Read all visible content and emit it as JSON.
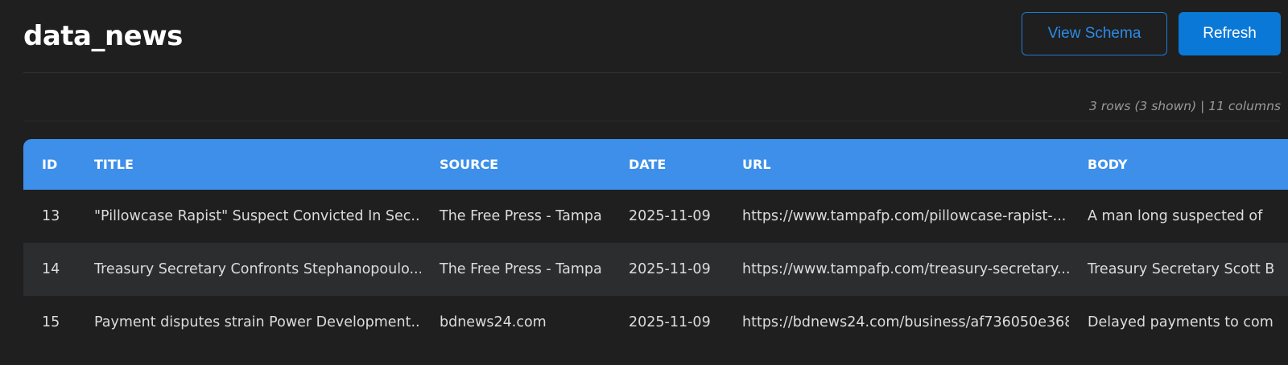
{
  "header": {
    "title": "data_news",
    "view_schema_label": "View Schema",
    "refresh_label": "Refresh"
  },
  "meta": {
    "summary": "3 rows (3 shown) | 11 columns"
  },
  "colors": {
    "header_bg": "#3d8fea",
    "primary_button": "#0a78d6",
    "outline_button": "#1f7ad6",
    "page_bg": "#1f1f1f",
    "alt_row_bg": "#2b2d2f"
  },
  "table": {
    "columns": [
      "ID",
      "TITLE",
      "SOURCE",
      "DATE",
      "URL",
      "BODY"
    ],
    "rows": [
      {
        "id": "13",
        "title": "\"Pillowcase Rapist\" Suspect Convicted In Sec...",
        "source": "The Free Press - Tampa",
        "date": "2025-11-09",
        "url": "https://www.tampafp.com/pillowcase-rapist-...",
        "body": "A man long suspected of"
      },
      {
        "id": "14",
        "title": "Treasury Secretary Confronts Stephanopoulo...",
        "source": "The Free Press - Tampa",
        "date": "2025-11-09",
        "url": "https://www.tampafp.com/treasury-secretary...",
        "body": "Treasury Secretary Scott B"
      },
      {
        "id": "15",
        "title": "Payment disputes strain Power Development...",
        "source": "bdnews24.com",
        "date": "2025-11-09",
        "url": "https://bdnews24.com/business/af736050e368",
        "body": "Delayed payments to com"
      }
    ]
  }
}
